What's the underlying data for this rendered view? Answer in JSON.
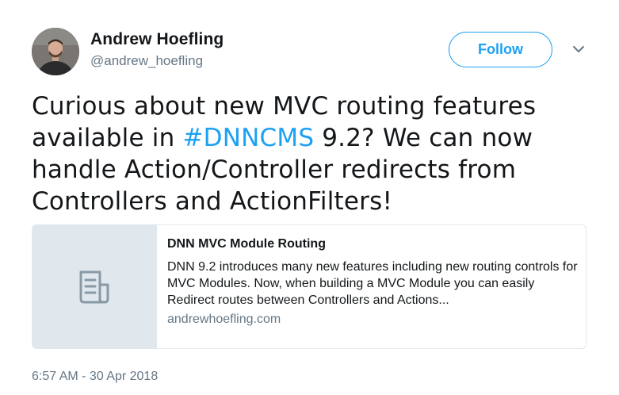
{
  "author": {
    "display_name": "Andrew Hoefling",
    "handle": "@andrew_hoefling",
    "avatar_icon": "profile-photo"
  },
  "header": {
    "follow_label": "Follow",
    "menu_icon": "chevron-down-icon"
  },
  "tweet": {
    "text_part1": "Curious about new MVC routing features available in ",
    "hashtag": "#DNNCMS",
    "text_part2": " 9.2? We can now handle Action/Controller redirects from Controllers and ActionFilters!"
  },
  "card": {
    "thumb_icon": "document-icon",
    "title": "DNN MVC Module Routing",
    "description": "DNN 9.2 introduces many new features including new routing controls for MVC Modules. Now, when building a MVC Module you can easily Redirect routes between Controllers and Actions...",
    "domain": "andrewhoefling.com"
  },
  "footer": {
    "timestamp": "6:57 AM - 30 Apr 2018"
  },
  "colors": {
    "accent": "#1da1f2",
    "text": "#14171a",
    "muted": "#657786",
    "border": "#e1e8ed"
  }
}
